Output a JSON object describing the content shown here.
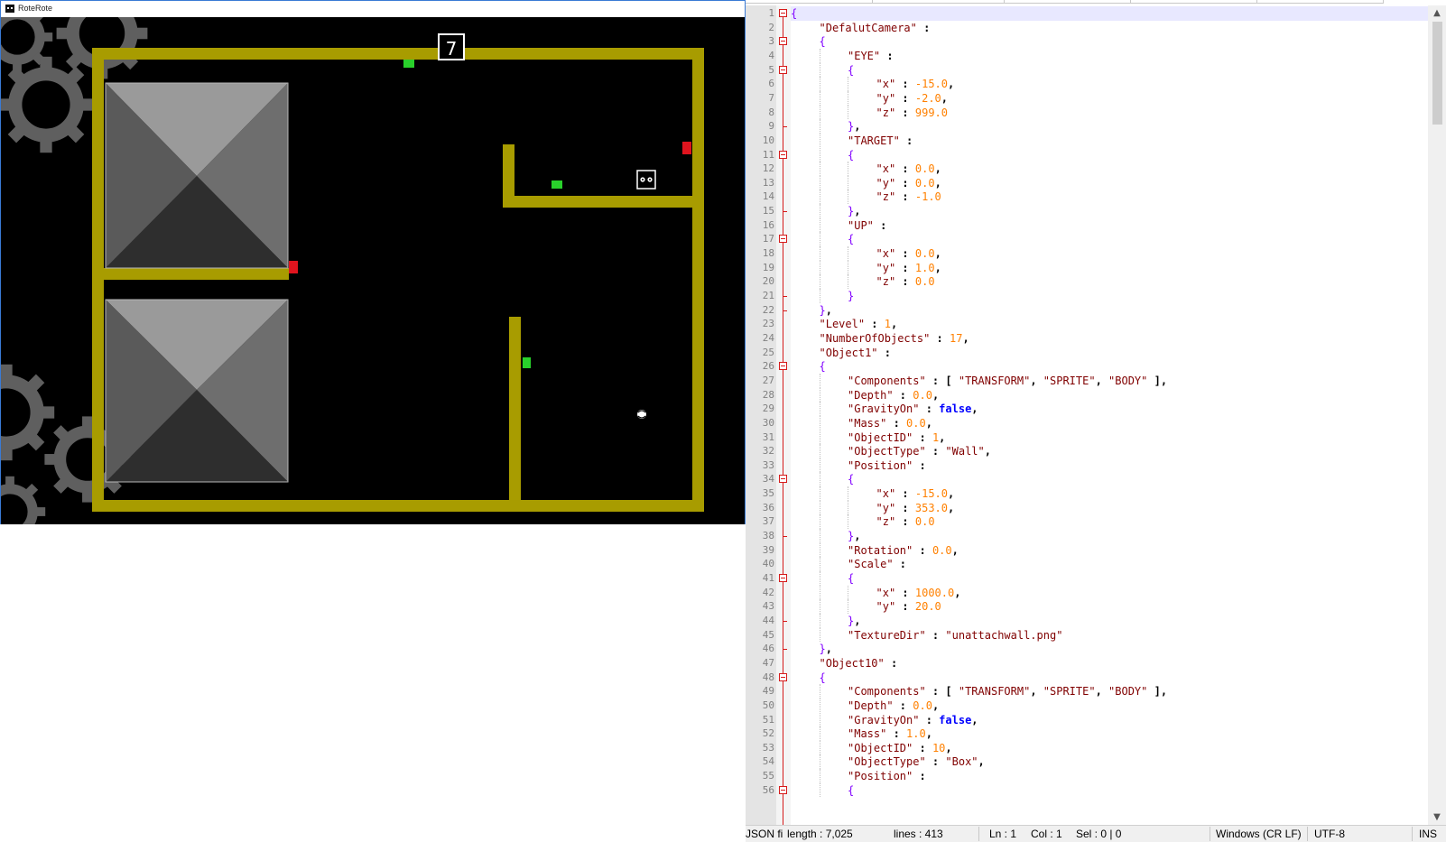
{
  "game": {
    "window_title": "RoteRote",
    "level_number": "7",
    "colors": {
      "wall": "#a89c00",
      "background": "#000000",
      "gear": "#606060",
      "switch_red": "#e0141e",
      "switch_green": "#29d12b"
    }
  },
  "editor": {
    "lines": [
      {
        "n": "1",
        "indent": 0,
        "tokens": [
          {
            "t": "{",
            "c": "t-brace"
          }
        ],
        "fold": "box"
      },
      {
        "n": "2",
        "indent": 1,
        "tokens": [
          {
            "t": "\"DefalutCamera\"",
            "c": "t-key"
          },
          {
            "t": " : ",
            "c": "t-punc"
          }
        ]
      },
      {
        "n": "3",
        "indent": 1,
        "tokens": [
          {
            "t": "{",
            "c": "t-brace"
          }
        ],
        "fold": "box"
      },
      {
        "n": "4",
        "indent": 2,
        "tokens": [
          {
            "t": "\"EYE\"",
            "c": "t-key"
          },
          {
            "t": " :",
            "c": "t-punc"
          }
        ]
      },
      {
        "n": "5",
        "indent": 2,
        "tokens": [
          {
            "t": "{",
            "c": "t-brace"
          }
        ],
        "fold": "box"
      },
      {
        "n": "6",
        "indent": 3,
        "tokens": [
          {
            "t": "\"x\"",
            "c": "t-key"
          },
          {
            "t": " : ",
            "c": "t-punc"
          },
          {
            "t": "-15.0",
            "c": "t-num"
          },
          {
            "t": ",",
            "c": "t-punc"
          }
        ]
      },
      {
        "n": "7",
        "indent": 3,
        "tokens": [
          {
            "t": "\"y\"",
            "c": "t-key"
          },
          {
            "t": " : ",
            "c": "t-punc"
          },
          {
            "t": "-2.0",
            "c": "t-num"
          },
          {
            "t": ",",
            "c": "t-punc"
          }
        ]
      },
      {
        "n": "8",
        "indent": 3,
        "tokens": [
          {
            "t": "\"z\"",
            "c": "t-key"
          },
          {
            "t": " : ",
            "c": "t-punc"
          },
          {
            "t": "999.0",
            "c": "t-num"
          }
        ]
      },
      {
        "n": "9",
        "indent": 2,
        "tokens": [
          {
            "t": "}",
            "c": "t-brace"
          },
          {
            "t": ",",
            "c": "t-punc"
          }
        ],
        "fold": "tick"
      },
      {
        "n": "10",
        "indent": 2,
        "tokens": [
          {
            "t": "\"TARGET\"",
            "c": "t-key"
          },
          {
            "t": " :",
            "c": "t-punc"
          }
        ]
      },
      {
        "n": "11",
        "indent": 2,
        "tokens": [
          {
            "t": "{",
            "c": "t-brace"
          }
        ],
        "fold": "box"
      },
      {
        "n": "12",
        "indent": 3,
        "tokens": [
          {
            "t": "\"x\"",
            "c": "t-key"
          },
          {
            "t": " : ",
            "c": "t-punc"
          },
          {
            "t": "0.0",
            "c": "t-num"
          },
          {
            "t": ",",
            "c": "t-punc"
          }
        ]
      },
      {
        "n": "13",
        "indent": 3,
        "tokens": [
          {
            "t": "\"y\"",
            "c": "t-key"
          },
          {
            "t": " : ",
            "c": "t-punc"
          },
          {
            "t": "0.0",
            "c": "t-num"
          },
          {
            "t": ",",
            "c": "t-punc"
          }
        ]
      },
      {
        "n": "14",
        "indent": 3,
        "tokens": [
          {
            "t": "\"z\"",
            "c": "t-key"
          },
          {
            "t": " : ",
            "c": "t-punc"
          },
          {
            "t": "-1.0",
            "c": "t-num"
          }
        ]
      },
      {
        "n": "15",
        "indent": 2,
        "tokens": [
          {
            "t": "}",
            "c": "t-brace"
          },
          {
            "t": ",",
            "c": "t-punc"
          }
        ],
        "fold": "tick"
      },
      {
        "n": "16",
        "indent": 2,
        "tokens": [
          {
            "t": "\"UP\"",
            "c": "t-key"
          },
          {
            "t": " :",
            "c": "t-punc"
          }
        ]
      },
      {
        "n": "17",
        "indent": 2,
        "tokens": [
          {
            "t": "{",
            "c": "t-brace"
          }
        ],
        "fold": "box"
      },
      {
        "n": "18",
        "indent": 3,
        "tokens": [
          {
            "t": "\"x\"",
            "c": "t-key"
          },
          {
            "t": " : ",
            "c": "t-punc"
          },
          {
            "t": "0.0",
            "c": "t-num"
          },
          {
            "t": ",",
            "c": "t-punc"
          }
        ]
      },
      {
        "n": "19",
        "indent": 3,
        "tokens": [
          {
            "t": "\"y\"",
            "c": "t-key"
          },
          {
            "t": " : ",
            "c": "t-punc"
          },
          {
            "t": "1.0",
            "c": "t-num"
          },
          {
            "t": ",",
            "c": "t-punc"
          }
        ]
      },
      {
        "n": "20",
        "indent": 3,
        "tokens": [
          {
            "t": "\"z\"",
            "c": "t-key"
          },
          {
            "t": " : ",
            "c": "t-punc"
          },
          {
            "t": "0.0",
            "c": "t-num"
          }
        ]
      },
      {
        "n": "21",
        "indent": 2,
        "tokens": [
          {
            "t": "}",
            "c": "t-brace"
          }
        ],
        "fold": "tick"
      },
      {
        "n": "22",
        "indent": 1,
        "tokens": [
          {
            "t": "}",
            "c": "t-brace"
          },
          {
            "t": ",",
            "c": "t-punc"
          }
        ],
        "fold": "tick"
      },
      {
        "n": "23",
        "indent": 1,
        "tokens": [
          {
            "t": "\"Level\"",
            "c": "t-key"
          },
          {
            "t": " : ",
            "c": "t-punc"
          },
          {
            "t": "1",
            "c": "t-num"
          },
          {
            "t": ",",
            "c": "t-punc"
          }
        ]
      },
      {
        "n": "24",
        "indent": 1,
        "tokens": [
          {
            "t": "\"NumberOfObjects\"",
            "c": "t-key"
          },
          {
            "t": " : ",
            "c": "t-punc"
          },
          {
            "t": "17",
            "c": "t-num"
          },
          {
            "t": ",",
            "c": "t-punc"
          }
        ]
      },
      {
        "n": "25",
        "indent": 1,
        "tokens": [
          {
            "t": "\"Object1\"",
            "c": "t-key"
          },
          {
            "t": " :",
            "c": "t-punc"
          }
        ]
      },
      {
        "n": "26",
        "indent": 1,
        "tokens": [
          {
            "t": "{",
            "c": "t-brace"
          }
        ],
        "fold": "box"
      },
      {
        "n": "27",
        "indent": 2,
        "tokens": [
          {
            "t": "\"Components\"",
            "c": "t-key"
          },
          {
            "t": " : ",
            "c": "t-punc"
          },
          {
            "t": "[ ",
            "c": "t-bracket"
          },
          {
            "t": "\"TRANSFORM\"",
            "c": "t-str"
          },
          {
            "t": ", ",
            "c": "t-punc"
          },
          {
            "t": "\"SPRITE\"",
            "c": "t-str"
          },
          {
            "t": ", ",
            "c": "t-punc"
          },
          {
            "t": "\"BODY\"",
            "c": "t-str"
          },
          {
            "t": " ]",
            "c": "t-bracket"
          },
          {
            "t": ",",
            "c": "t-punc"
          }
        ]
      },
      {
        "n": "28",
        "indent": 2,
        "tokens": [
          {
            "t": "\"Depth\"",
            "c": "t-key"
          },
          {
            "t": " : ",
            "c": "t-punc"
          },
          {
            "t": "0.0",
            "c": "t-num"
          },
          {
            "t": ",",
            "c": "t-punc"
          }
        ]
      },
      {
        "n": "29",
        "indent": 2,
        "tokens": [
          {
            "t": "\"GravityOn\"",
            "c": "t-key"
          },
          {
            "t": " : ",
            "c": "t-punc"
          },
          {
            "t": "false",
            "c": "t-bool"
          },
          {
            "t": ",",
            "c": "t-punc"
          }
        ]
      },
      {
        "n": "30",
        "indent": 2,
        "tokens": [
          {
            "t": "\"Mass\"",
            "c": "t-key"
          },
          {
            "t": " : ",
            "c": "t-punc"
          },
          {
            "t": "0.0",
            "c": "t-num"
          },
          {
            "t": ",",
            "c": "t-punc"
          }
        ]
      },
      {
        "n": "31",
        "indent": 2,
        "tokens": [
          {
            "t": "\"ObjectID\"",
            "c": "t-key"
          },
          {
            "t": " : ",
            "c": "t-punc"
          },
          {
            "t": "1",
            "c": "t-num"
          },
          {
            "t": ",",
            "c": "t-punc"
          }
        ]
      },
      {
        "n": "32",
        "indent": 2,
        "tokens": [
          {
            "t": "\"ObjectType\"",
            "c": "t-key"
          },
          {
            "t": " : ",
            "c": "t-punc"
          },
          {
            "t": "\"Wall\"",
            "c": "t-str"
          },
          {
            "t": ",",
            "c": "t-punc"
          }
        ]
      },
      {
        "n": "33",
        "indent": 2,
        "tokens": [
          {
            "t": "\"Position\"",
            "c": "t-key"
          },
          {
            "t": " :",
            "c": "t-punc"
          }
        ]
      },
      {
        "n": "34",
        "indent": 2,
        "tokens": [
          {
            "t": "{",
            "c": "t-brace"
          }
        ],
        "fold": "box"
      },
      {
        "n": "35",
        "indent": 3,
        "tokens": [
          {
            "t": "\"x\"",
            "c": "t-key"
          },
          {
            "t": " : ",
            "c": "t-punc"
          },
          {
            "t": "-15.0",
            "c": "t-num"
          },
          {
            "t": ",",
            "c": "t-punc"
          }
        ]
      },
      {
        "n": "36",
        "indent": 3,
        "tokens": [
          {
            "t": "\"y\"",
            "c": "t-key"
          },
          {
            "t": " : ",
            "c": "t-punc"
          },
          {
            "t": "353.0",
            "c": "t-num"
          },
          {
            "t": ",",
            "c": "t-punc"
          }
        ]
      },
      {
        "n": "37",
        "indent": 3,
        "tokens": [
          {
            "t": "\"z\"",
            "c": "t-key"
          },
          {
            "t": " : ",
            "c": "t-punc"
          },
          {
            "t": "0.0",
            "c": "t-num"
          }
        ]
      },
      {
        "n": "38",
        "indent": 2,
        "tokens": [
          {
            "t": "}",
            "c": "t-brace"
          },
          {
            "t": ",",
            "c": "t-punc"
          }
        ],
        "fold": "tick"
      },
      {
        "n": "39",
        "indent": 2,
        "tokens": [
          {
            "t": "\"Rotation\"",
            "c": "t-key"
          },
          {
            "t": " : ",
            "c": "t-punc"
          },
          {
            "t": "0.0",
            "c": "t-num"
          },
          {
            "t": ",",
            "c": "t-punc"
          }
        ]
      },
      {
        "n": "40",
        "indent": 2,
        "tokens": [
          {
            "t": "\"Scale\"",
            "c": "t-key"
          },
          {
            "t": " :",
            "c": "t-punc"
          }
        ]
      },
      {
        "n": "41",
        "indent": 2,
        "tokens": [
          {
            "t": "{",
            "c": "t-brace"
          }
        ],
        "fold": "box"
      },
      {
        "n": "42",
        "indent": 3,
        "tokens": [
          {
            "t": "\"x\"",
            "c": "t-key"
          },
          {
            "t": " : ",
            "c": "t-punc"
          },
          {
            "t": "1000.0",
            "c": "t-num"
          },
          {
            "t": ",",
            "c": "t-punc"
          }
        ]
      },
      {
        "n": "43",
        "indent": 3,
        "tokens": [
          {
            "t": "\"y\"",
            "c": "t-key"
          },
          {
            "t": " : ",
            "c": "t-punc"
          },
          {
            "t": "20.0",
            "c": "t-num"
          }
        ]
      },
      {
        "n": "44",
        "indent": 2,
        "tokens": [
          {
            "t": "}",
            "c": "t-brace"
          },
          {
            "t": ",",
            "c": "t-punc"
          }
        ],
        "fold": "tick"
      },
      {
        "n": "45",
        "indent": 2,
        "tokens": [
          {
            "t": "\"TextureDir\"",
            "c": "t-key"
          },
          {
            "t": " : ",
            "c": "t-punc"
          },
          {
            "t": "\"unattachwall.png\"",
            "c": "t-str"
          }
        ]
      },
      {
        "n": "46",
        "indent": 1,
        "tokens": [
          {
            "t": "}",
            "c": "t-brace"
          },
          {
            "t": ",",
            "c": "t-punc"
          }
        ],
        "fold": "tick"
      },
      {
        "n": "47",
        "indent": 1,
        "tokens": [
          {
            "t": "\"Object10\"",
            "c": "t-key"
          },
          {
            "t": " :",
            "c": "t-punc"
          }
        ]
      },
      {
        "n": "48",
        "indent": 1,
        "tokens": [
          {
            "t": "{",
            "c": "t-brace"
          }
        ],
        "fold": "box"
      },
      {
        "n": "49",
        "indent": 2,
        "tokens": [
          {
            "t": "\"Components\"",
            "c": "t-key"
          },
          {
            "t": " : ",
            "c": "t-punc"
          },
          {
            "t": "[ ",
            "c": "t-bracket"
          },
          {
            "t": "\"TRANSFORM\"",
            "c": "t-str"
          },
          {
            "t": ", ",
            "c": "t-punc"
          },
          {
            "t": "\"SPRITE\"",
            "c": "t-str"
          },
          {
            "t": ", ",
            "c": "t-punc"
          },
          {
            "t": "\"BODY\"",
            "c": "t-str"
          },
          {
            "t": " ]",
            "c": "t-bracket"
          },
          {
            "t": ",",
            "c": "t-punc"
          }
        ]
      },
      {
        "n": "50",
        "indent": 2,
        "tokens": [
          {
            "t": "\"Depth\"",
            "c": "t-key"
          },
          {
            "t": " : ",
            "c": "t-punc"
          },
          {
            "t": "0.0",
            "c": "t-num"
          },
          {
            "t": ",",
            "c": "t-punc"
          }
        ]
      },
      {
        "n": "51",
        "indent": 2,
        "tokens": [
          {
            "t": "\"GravityOn\"",
            "c": "t-key"
          },
          {
            "t": " : ",
            "c": "t-punc"
          },
          {
            "t": "false",
            "c": "t-bool"
          },
          {
            "t": ",",
            "c": "t-punc"
          }
        ]
      },
      {
        "n": "52",
        "indent": 2,
        "tokens": [
          {
            "t": "\"Mass\"",
            "c": "t-key"
          },
          {
            "t": " : ",
            "c": "t-punc"
          },
          {
            "t": "1.0",
            "c": "t-num"
          },
          {
            "t": ",",
            "c": "t-punc"
          }
        ]
      },
      {
        "n": "53",
        "indent": 2,
        "tokens": [
          {
            "t": "\"ObjectID\"",
            "c": "t-key"
          },
          {
            "t": " : ",
            "c": "t-punc"
          },
          {
            "t": "10",
            "c": "t-num"
          },
          {
            "t": ",",
            "c": "t-punc"
          }
        ]
      },
      {
        "n": "54",
        "indent": 2,
        "tokens": [
          {
            "t": "\"ObjectType\"",
            "c": "t-key"
          },
          {
            "t": " : ",
            "c": "t-punc"
          },
          {
            "t": "\"Box\"",
            "c": "t-str"
          },
          {
            "t": ",",
            "c": "t-punc"
          }
        ]
      },
      {
        "n": "55",
        "indent": 2,
        "tokens": [
          {
            "t": "\"Position\"",
            "c": "t-key"
          },
          {
            "t": " :",
            "c": "t-punc"
          }
        ]
      },
      {
        "n": "56",
        "indent": 2,
        "tokens": [
          {
            "t": "{",
            "c": "t-brace"
          }
        ],
        "fold": "box"
      }
    ],
    "status": {
      "file_type": "JSON fi",
      "length": "length : 7,025",
      "lines": "lines : 413",
      "ln": "Ln : 1",
      "col": "Col : 1",
      "sel": "Sel : 0 | 0",
      "eol": "Windows (CR LF)",
      "encoding": "UTF-8",
      "mode": "INS"
    },
    "icons": {
      "scroll_up": "▲",
      "scroll_down": "▼"
    }
  }
}
